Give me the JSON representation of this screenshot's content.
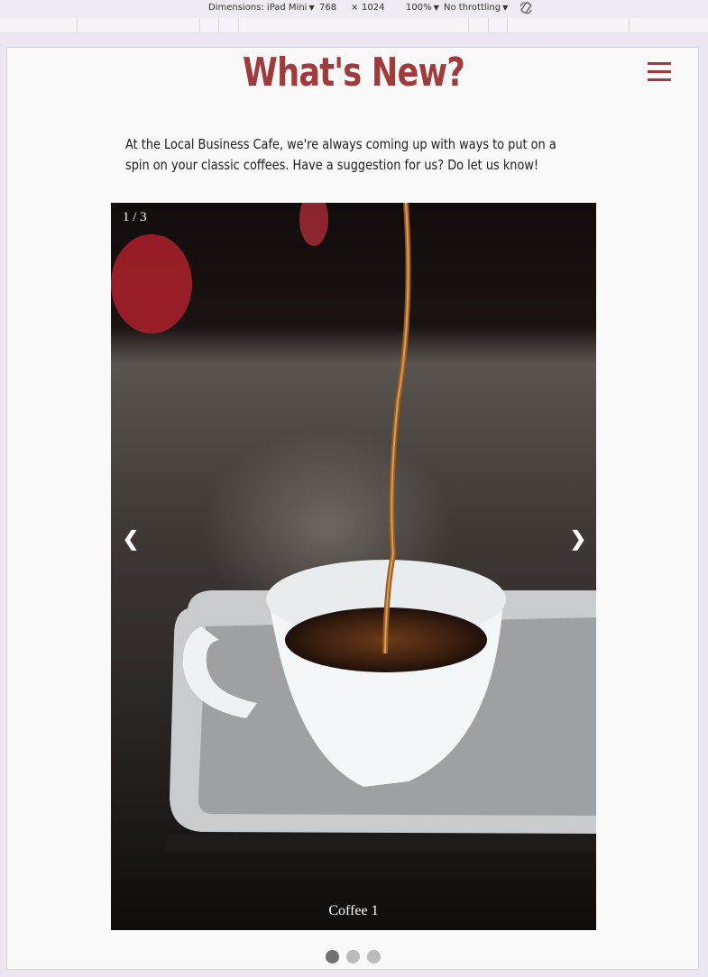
{
  "devtools": {
    "dimensions_label": "Dimensions: iPad Mini",
    "width": "768",
    "times": "×",
    "height": "1024",
    "zoom": "100%",
    "throttling": "No throttling",
    "rotate_icon": "rotate-icon"
  },
  "page": {
    "title": "What's New?",
    "menu_icon": "hamburger-icon",
    "intro": "At the Local Business Cafe, we're always coming up with ways to put on a spin on your classic coffees. Have a suggestion for us? Do let us know!"
  },
  "slideshow": {
    "counter": "1 / 3",
    "caption": "Coffee 1",
    "prev_symbol": "❮",
    "next_symbol": "❯",
    "dots": [
      {
        "active": true
      },
      {
        "active": false
      },
      {
        "active": false
      }
    ]
  },
  "colors": {
    "accent": "#a13b3b",
    "dot_active": "#717171",
    "dot_inactive": "#bbbbbb"
  }
}
